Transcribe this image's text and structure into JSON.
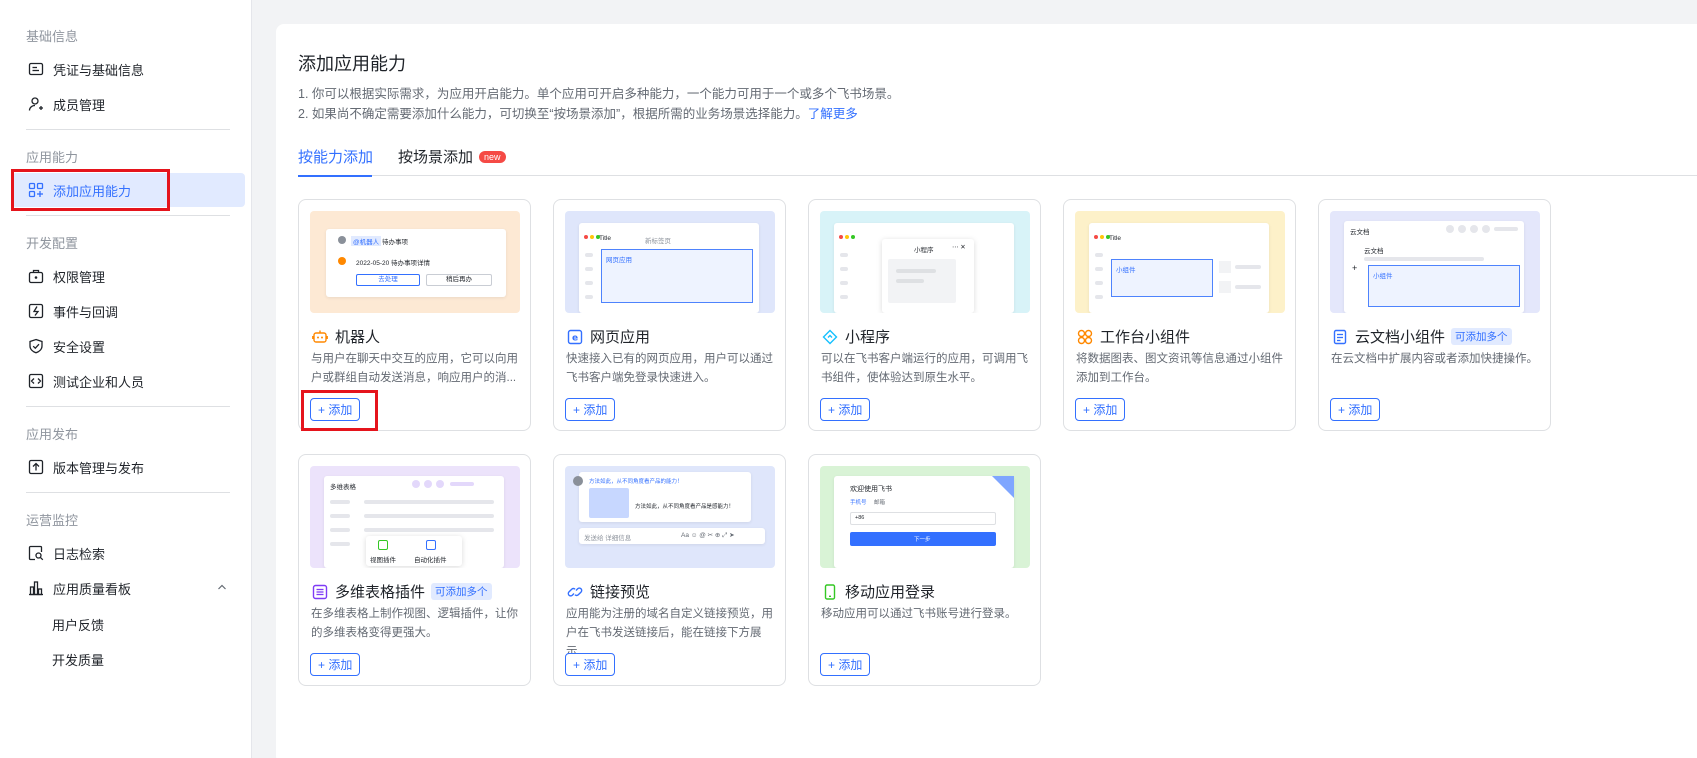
{
  "sidebar": {
    "sections": [
      {
        "label": "基础信息"
      },
      {
        "label": "应用能力"
      },
      {
        "label": "开发配置"
      },
      {
        "label": "应用发布"
      },
      {
        "label": "运营监控"
      }
    ],
    "items": [
      {
        "label": "凭证与基础信息",
        "icon": "credential-icon"
      },
      {
        "label": "成员管理",
        "icon": "member-icon"
      },
      {
        "label": "添加应用能力",
        "icon": "add-capability-icon",
        "active": true
      },
      {
        "label": "权限管理",
        "icon": "permission-icon"
      },
      {
        "label": "事件与回调",
        "icon": "event-icon"
      },
      {
        "label": "安全设置",
        "icon": "shield-icon"
      },
      {
        "label": "测试企业和人员",
        "icon": "test-icon"
      },
      {
        "label": "版本管理与发布",
        "icon": "upload-icon"
      },
      {
        "label": "日志检索",
        "icon": "log-search-icon"
      },
      {
        "label": "应用质量看板",
        "icon": "bar-chart-icon"
      }
    ],
    "subitems": [
      {
        "label": "用户反馈"
      },
      {
        "label": "开发质量"
      }
    ]
  },
  "main": {
    "title": "添加应用能力",
    "desc1": "1. 你可以根据实际需求，为应用开启能力。单个应用可开启多种能力，一个能力可用于一个或多个飞书场景。",
    "desc2": "2. 如果尚不确定需要添加什么能力，可切换至“按场景添加”，根据所需的业务场景选择能力。",
    "learn_more": "了解更多",
    "tabs": [
      {
        "label": "按能力添加",
        "active": true
      },
      {
        "label": "按场景添加",
        "badge": "new"
      }
    ]
  },
  "cards": [
    {
      "title": "机器人",
      "icon": "robot-icon",
      "tag": "",
      "desc": "与用户在聊天中交互的应用，它可以向用户或群组自动发送消息，响应用户的消...",
      "button": "+ 添加"
    },
    {
      "title": "网页应用",
      "icon": "web-app-icon",
      "tag": "",
      "desc": "快速接入已有的网页应用，用户可以通过飞书客户端免登录快速进入。",
      "button": "+ 添加"
    },
    {
      "title": "小程序",
      "icon": "mini-program-icon",
      "tag": "",
      "desc": "可以在飞书客户端运行的应用，可调用飞书组件，使体验达到原生水平。",
      "button": "+ 添加"
    },
    {
      "title": "工作台小组件",
      "icon": "widget-icon",
      "tag": "",
      "desc": "将数据图表、图文资讯等信息通过小组件添加到工作台。",
      "button": "+ 添加"
    },
    {
      "title": "云文档小组件",
      "icon": "doc-widget-icon",
      "tag": "可添加多个",
      "desc": "在云文档中扩展内容或者添加快捷操作。",
      "button": "+ 添加"
    },
    {
      "title": "多维表格插件",
      "icon": "bitable-plugin-icon",
      "tag": "可添加多个",
      "desc": "在多维表格上制作视图、逻辑插件，让你的多维表格变得更强大。",
      "button": "+ 添加"
    },
    {
      "title": "链接预览",
      "icon": "link-icon",
      "tag": "",
      "desc": "应用能为注册的域名自定义链接预览，用户在飞书发送链接后，能在链接下方展示...",
      "button": "+ 添加"
    },
    {
      "title": "移动应用登录",
      "icon": "mobile-icon",
      "tag": "",
      "desc": "移动应用可以通过飞书账号进行登录。",
      "button": "+ 添加"
    }
  ],
  "thumbs": {
    "robot": {
      "chip": "@机器人",
      "chip2": "待办事项",
      "date_line": "2022-05-20 待办事项详情",
      "btn1": "去处理",
      "btn2": "稍后再办"
    },
    "web": {
      "tab1": "Title",
      "tab2": "新标签页",
      "label": "网页应用"
    },
    "mini": {
      "title": "小程序"
    },
    "widget": {
      "tab": "Title",
      "label": "小组件"
    },
    "doc": {
      "back": "云文档",
      "heading": "云文档",
      "label": "小组件"
    },
    "bitable": {
      "title": "多维表格",
      "btn1": "视图插件",
      "btn2": "自动化插件"
    },
    "link": {
      "text1": "方法如此，从不同角度看产品的能力！",
      "text2": "方法如此，从不同角度看产品是感能力！",
      "input": "发送给 详细信息"
    },
    "login": {
      "title": "欢迎使用飞书",
      "tab1": "手机号",
      "tab2": "邮箱",
      "code": "+86",
      "btn": "下一步"
    }
  }
}
